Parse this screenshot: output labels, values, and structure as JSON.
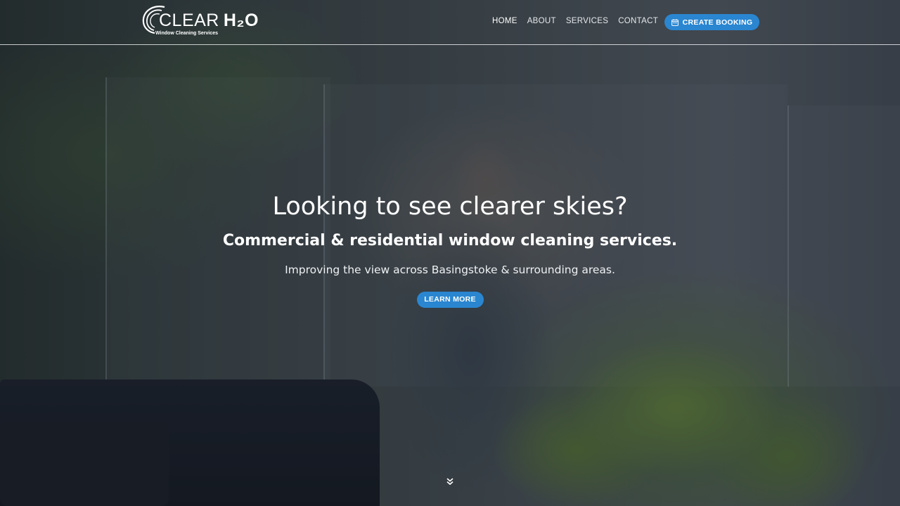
{
  "header": {
    "logo": {
      "name_part1": "CLEAR",
      "name_part2": "H₂O",
      "tagline": "Window Cleaning Services"
    },
    "nav": [
      {
        "label": "HOME",
        "active": true
      },
      {
        "label": "ABOUT",
        "active": false
      },
      {
        "label": "SERVICES",
        "active": false
      },
      {
        "label": "CONTACT",
        "active": false
      }
    ],
    "booking_button": {
      "label": "CREATE BOOKING",
      "icon": "calendar-icon"
    }
  },
  "hero": {
    "title": "Looking to see clearer skies?",
    "subtitle": "Commercial & residential window cleaning services.",
    "text": "Improving the view across Basingstoke & surrounding areas.",
    "cta_label": "LEARN MORE",
    "scroll_icon": "double-chevron-down-icon"
  },
  "colors": {
    "accent": "#2a86d1",
    "text": "#ffffff"
  }
}
